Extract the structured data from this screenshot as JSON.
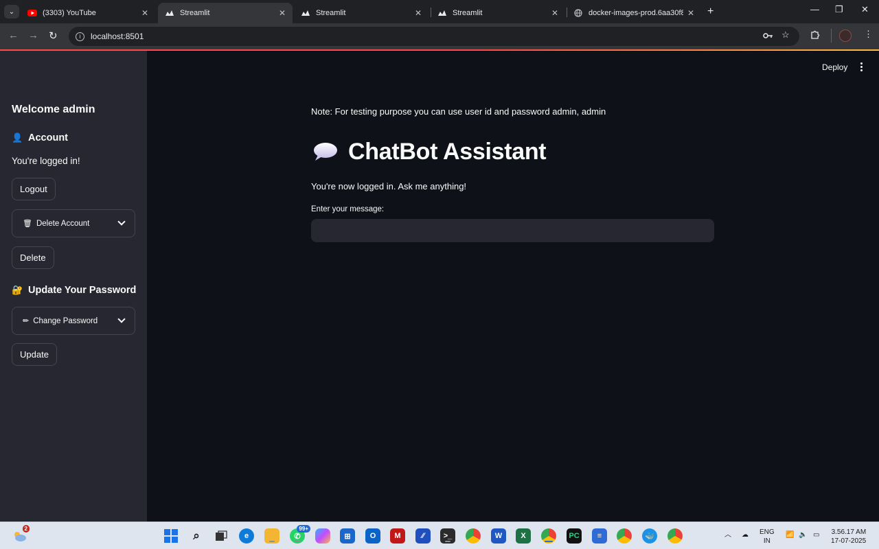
{
  "browser": {
    "tabs": [
      {
        "title": "(3303) YouTube",
        "icon": "youtube-icon",
        "active": false
      },
      {
        "title": "Streamlit",
        "icon": "streamlit-icon",
        "active": true
      },
      {
        "title": "Streamlit",
        "icon": "streamlit-icon",
        "active": false
      },
      {
        "title": "Streamlit",
        "icon": "streamlit-icon",
        "active": false
      },
      {
        "title": "docker-images-prod.6aa30f8b0",
        "icon": "globe-icon",
        "active": false
      }
    ],
    "url": "localhost:8501"
  },
  "sidebar": {
    "welcome": "Welcome admin",
    "account_heading": "Account",
    "account_emoji": "👤",
    "logged_in_text": "You're logged in!",
    "logout_label": "Logout",
    "delete_expander_label": "Delete Account",
    "delete_expander_emoji": "🗑",
    "delete_label": "Delete",
    "password_heading": "Update Your Password",
    "password_emoji": "🔐",
    "change_expander_label": "Change Password",
    "change_expander_emoji": "✏",
    "update_label": "Update"
  },
  "main": {
    "deploy_label": "Deploy",
    "note": "Note: For testing purpose you can use user id and password admin, admin",
    "title": "ChatBot Assistant",
    "title_icon": "speech-bubble-icon",
    "subtitle": "You're now logged in. Ask me anything!",
    "input_label": "Enter your message:",
    "input_value": ""
  },
  "taskbar": {
    "weather_badge": "2",
    "whatsapp_badge": "99+",
    "language_line1": "ENG",
    "language_line2": "IN",
    "time": "3.56.17 AM",
    "date": "17-07-2025"
  },
  "colors": {
    "app_bg": "#0e1117",
    "sidebar_bg": "#262730",
    "accent": "#ff4b4b",
    "text": "#fafafa"
  }
}
